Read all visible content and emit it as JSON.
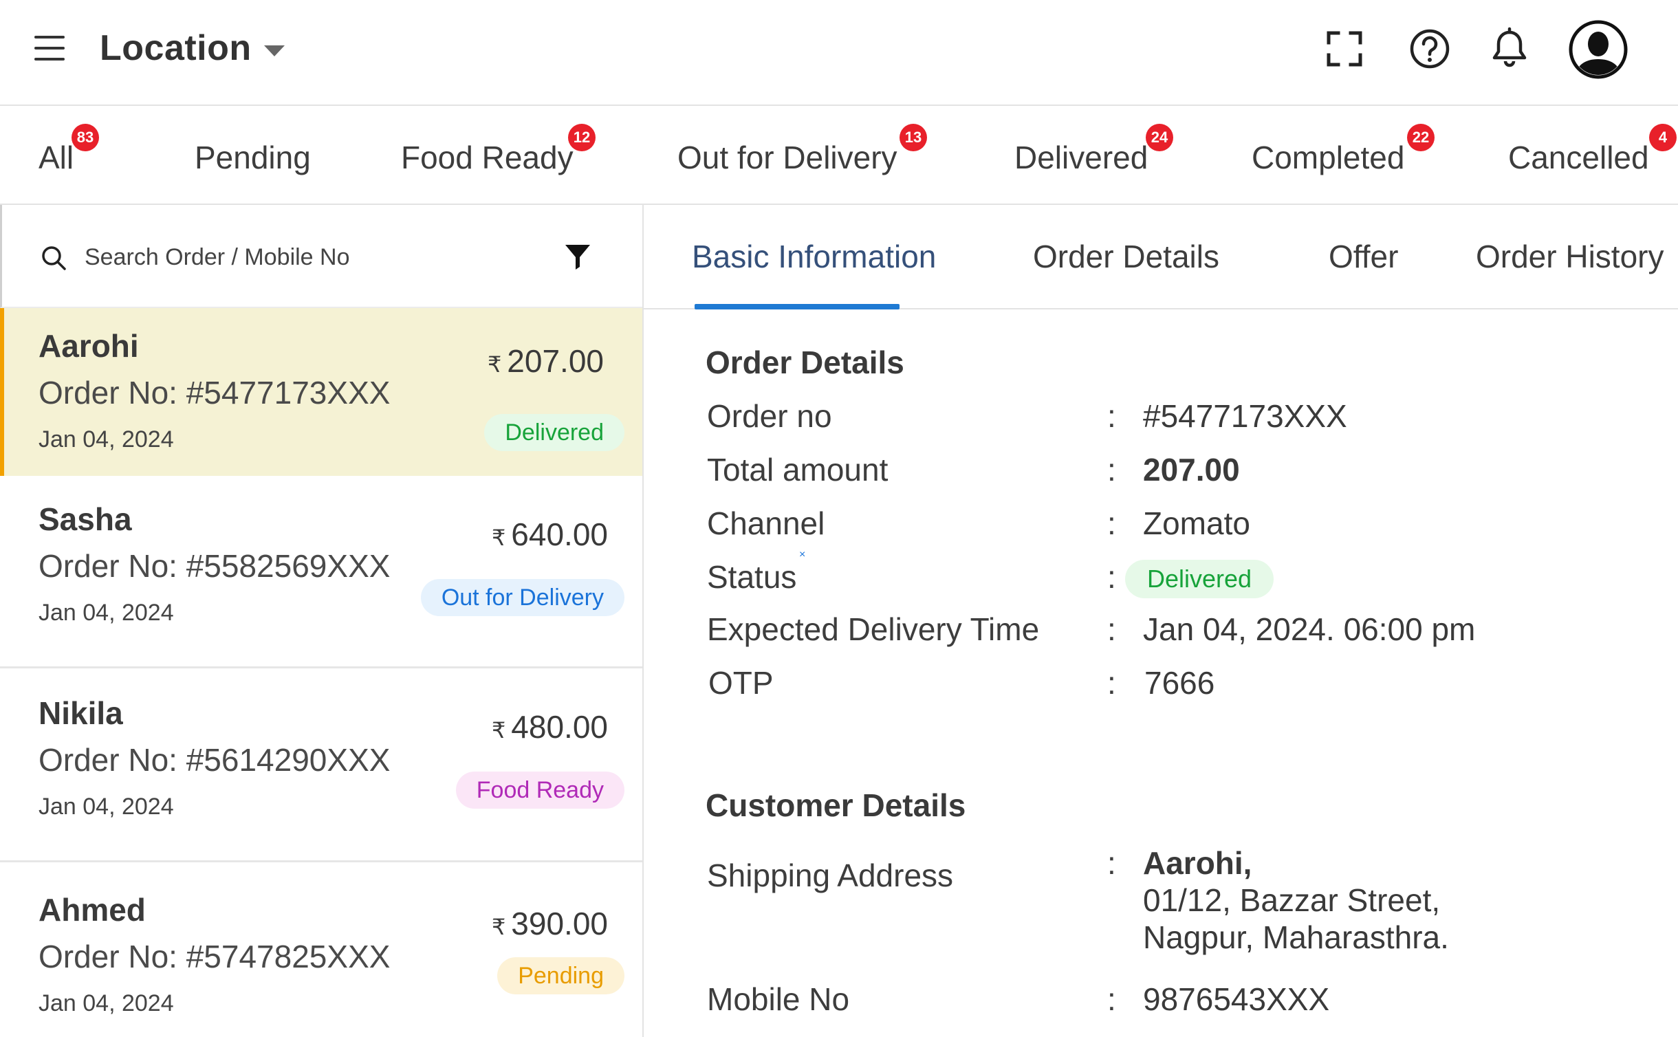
{
  "header": {
    "location_label": "Location",
    "icons": [
      "menu-icon",
      "fullscreen-icon",
      "help-icon",
      "bell-icon",
      "user-avatar-icon"
    ]
  },
  "status_tabs": [
    {
      "label": "All",
      "count": "83"
    },
    {
      "label": "Pending",
      "count": ""
    },
    {
      "label": "Food Ready",
      "count": "12"
    },
    {
      "label": "Out for Delivery",
      "count": "13"
    },
    {
      "label": "Delivered",
      "count": "24"
    },
    {
      "label": "Completed",
      "count": "22"
    },
    {
      "label": "Cancelled",
      "count": "4"
    }
  ],
  "search": {
    "placeholder": "Search Order / Mobile No",
    "value": ""
  },
  "currency_symbol": "₹",
  "orders": [
    {
      "name": "Aarohi",
      "order_no": "Order No: #5477173XXX",
      "date": "Jan 04, 2024",
      "amount": "207.00",
      "status": "Delivered",
      "status_color": "#17a33a"
    },
    {
      "name": "Sasha",
      "order_no": "Order No: #5582569XXX",
      "date": "Jan 04, 2024",
      "amount": "640.00",
      "status": "Out for Delivery",
      "status_color": "#1a73d9"
    },
    {
      "name": "Nikila",
      "order_no": "Order No: #5614290XXX",
      "date": "Jan 04, 2024",
      "amount": "480.00",
      "status": "Food Ready",
      "status_color": "#b02ab7"
    },
    {
      "name": "Ahmed",
      "order_no": "Order No: #5747825XXX",
      "date": "Jan 04, 2024",
      "amount": "390.00",
      "status": "Pending",
      "status_color": "#e89c00"
    }
  ],
  "detail_tabs": [
    "Basic Information",
    "Order Details",
    "Offer",
    "Order History"
  ],
  "active_detail_tab": "Basic Information",
  "accent_color": "#1f7ad3",
  "order_details": {
    "title": "Order Details",
    "rows": [
      {
        "label": "Order no",
        "value": "#5477173XXX"
      },
      {
        "label": "Total amount",
        "value": "207.00"
      },
      {
        "label": "Channel",
        "value": "Zomato"
      },
      {
        "label": "Status",
        "value": "Delivered"
      },
      {
        "label": "Expected Delivery Time",
        "value": "Jan 04, 2024. 06:00 pm"
      },
      {
        "label": "OTP",
        "value": "7666"
      }
    ],
    "colon": ":",
    "status_marker": "×"
  },
  "customer_details": {
    "title": "Customer Details",
    "shipping_label": "Shipping Address",
    "shipping_name": "Aarohi,",
    "shipping_line1": "01/12, Bazzar Street,",
    "shipping_line2": "Nagpur, Maharasthra.",
    "mobile_label": "Mobile No",
    "mobile_value": "9876543XXX"
  }
}
